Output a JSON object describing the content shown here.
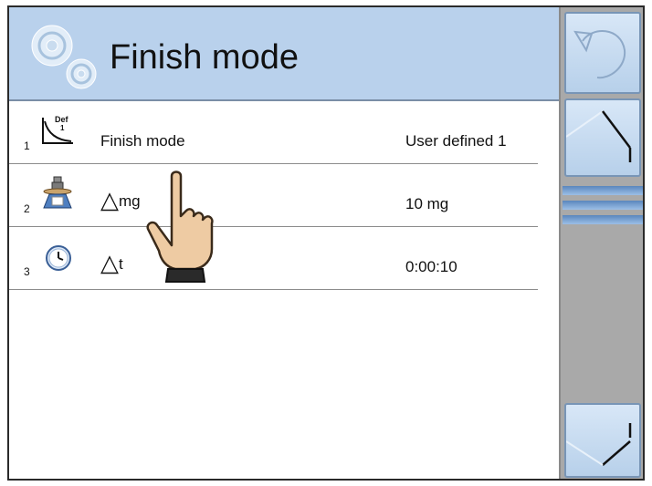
{
  "header": {
    "title": "Finish mode",
    "icon": "settings-gears-icon"
  },
  "rows": [
    {
      "number": "1",
      "icon": "def-curve-icon",
      "icon_text": "Def",
      "icon_sub": "1",
      "label": "Finish mode",
      "value": "User defined 1"
    },
    {
      "number": "2",
      "icon": "scale-weight-icon",
      "label_symbol": "△",
      "label_suffix": "mg",
      "value": "10 mg"
    },
    {
      "number": "3",
      "icon": "clock-icon",
      "label_symbol": "△",
      "label_suffix": "t",
      "value": "0:00:10"
    }
  ],
  "sidebar": {
    "back_icon": "undo-arrow-icon",
    "up_icon": "scroll-up-icon",
    "down_icon": "scroll-down-icon"
  },
  "colors": {
    "header_bg": "#b9d1ec",
    "sidebar_bg": "#a9a9a9",
    "button_bg": "#c8dcf2",
    "scrollbar": "#6c95c8"
  }
}
